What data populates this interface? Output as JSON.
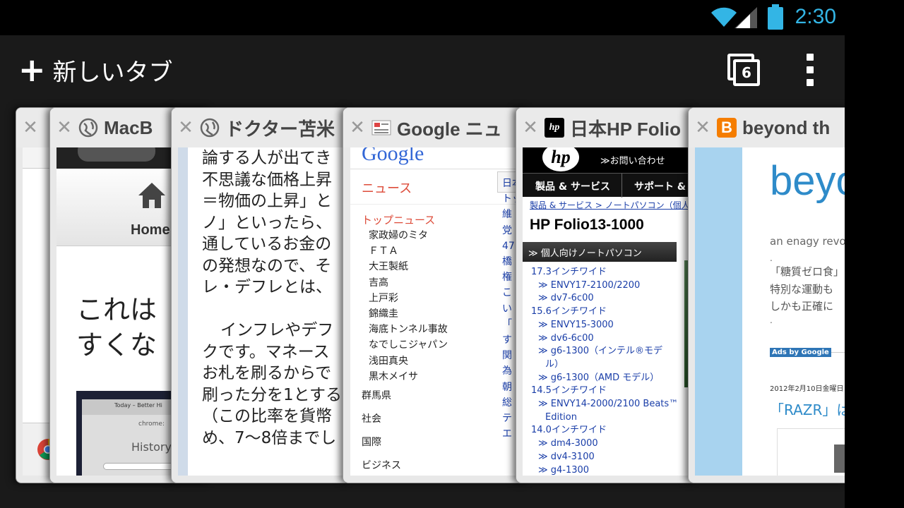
{
  "status": {
    "time": "2:30"
  },
  "toolbar": {
    "new_tab_label": "新しいタブ",
    "tab_count": "6"
  },
  "tabs": [
    {
      "title": "",
      "page": {}
    },
    {
      "title": "MacB",
      "page": {
        "home": "Home",
        "heading": "これは\nすくな",
        "history": "History",
        "chrome_tab": "Today – Better Hi",
        "address": "chrome:"
      }
    },
    {
      "title": "ドクター苫米",
      "page": {
        "lines": [
          "論する人が出てき",
          "不思議な価格上昇",
          "＝物価の上昇」と",
          "ノ」といったら、",
          "通しているお金の",
          "の発想なので、そ",
          "レ・デフレとは、",
          "",
          "インフレやデフ",
          "クです。マネース",
          "お札を刷るからで",
          "刷った分を1とする",
          "（この比率を貨幣",
          "め、7〜8倍までし"
        ]
      }
    },
    {
      "title": "Google ニュ",
      "page": {
        "logo": "Google",
        "section": "ニュース",
        "top_news": "トップニュース",
        "items": [
          "家政婦のミタ",
          "ＦＴＡ",
          "大王製紙",
          "吉高",
          "上戸彩",
          "錦織圭",
          "海底トンネル事故",
          "なでしこジャパン",
          "浅田真央",
          "黒木メイサ"
        ],
        "categories": [
          "群馬県",
          "社会",
          "国際",
          "ビジネス"
        ],
        "right_col": [
          "日本",
          "トッ",
          "維",
          "党",
          "47",
          "橋",
          "権",
          "こ",
          "い",
          "「",
          "す",
          "関",
          "為",
          "朝",
          "総",
          "テ",
          "エ"
        ]
      }
    },
    {
      "title": "日本HP Folio",
      "page": {
        "contact": "≫お問い合わせ",
        "nav": [
          "製品 & サービス",
          "サポート &"
        ],
        "breadcrumb": "製品 & サービス > ノートパソコン（個人",
        "heading": "HP Folio13-1000",
        "band": "≫ 個人向けノートパソコン",
        "list": [
          "17.3インチワイド",
          "≫ ENVY17-2100/2200",
          "≫ dv7-6c00",
          "15.6インチワイド",
          "≫ ENVY15-3000",
          "≫ dv6-6c00",
          "≫ g6-1300（インテル®モデ",
          "ル）",
          "≫ g6-1300（AMD モデル）",
          "14.5インチワイド",
          "≫ ENVY14-2000/2100 Beats™",
          "Edition",
          "14.0インチワイド",
          "≫ dm4-3000",
          "≫ dv4-3100",
          "≫ g4-1300"
        ]
      }
    },
    {
      "title": "beyond th",
      "page": {
        "heading": "beyo",
        "tagline": "an enagy revo",
        "dot": ".",
        "lines": [
          "「糖質ゼロ食」",
          "特別な運動も",
          "しかも正確に"
        ],
        "dot2": ".",
        "ads": "Ads by Google",
        "date": "2012年2月10日金曜日",
        "post": "「RAZR」は"
      }
    }
  ],
  "colors": {
    "accent": "#33b5e5",
    "toolbar": "#1a1a1a",
    "google_red": "#dd4b39",
    "hp_blue": "#1a3ea8"
  }
}
